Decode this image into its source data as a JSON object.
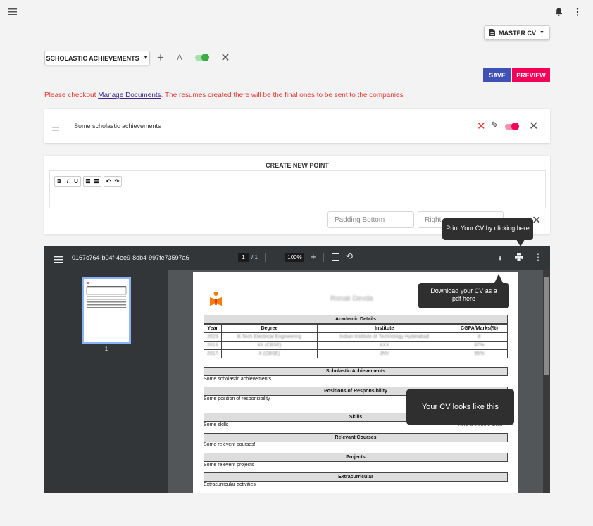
{
  "header": {
    "master_cv_label": "MASTER CV"
  },
  "section_select": {
    "label": "SCHOLASTIC ACHIEVEMENTS"
  },
  "actions": {
    "save_label": "SAVE",
    "preview_label": "PREVIEW"
  },
  "notice": {
    "prefix": "Please checkout ",
    "link_text": "Manage Documents",
    "suffix": ". The resumes created there will be the final ones to be sent to the companies"
  },
  "point": {
    "text": "Some scholastic achievements"
  },
  "create_point": {
    "title": "CREATE NEW POINT",
    "toolbar": [
      "B",
      "I",
      "U"
    ],
    "padding_bottom_placeholder": "Padding Bottom",
    "right_placeholder": "Right"
  },
  "tooltips": {
    "print": "Print Your CV by clicking here",
    "download": "Download your CV as a pdf here",
    "cv_preview": "Your CV looks like this"
  },
  "pdf_viewer": {
    "filename": "0167c764-b04f-4ee9-8db4-997fe73597a6",
    "page_current": "1",
    "page_total": "/ 1",
    "zoom": "100%",
    "thumb_label": "1"
  },
  "cv": {
    "name": "Ronak Devda",
    "academic_title": "Academic Details",
    "columns": [
      "Year",
      "Degree",
      "Institute",
      "CGPA/Marks(%)"
    ],
    "rows": [
      [
        "2023",
        "B.Tech Electrical Engineering",
        "Indian Institute of Technology Hyderabad",
        "8"
      ],
      [
        "2019",
        "XII (CBSE)",
        "XXX",
        "87%"
      ],
      [
        "2017",
        "X (CBSE)",
        "JNV",
        "95%"
      ]
    ],
    "sections": [
      {
        "title": "Scholastic Achievements",
        "text": "Some scholastic achievements"
      },
      {
        "title": "Positions of Responsibility",
        "text": "Some position of responsibility"
      },
      {
        "title": "Skills",
        "text": "Some skills",
        "right_text": "here are some skills"
      },
      {
        "title": "Relevant Courses",
        "text": "Some relevent courses!!"
      },
      {
        "title": "Projects",
        "text": "Some relevent projects"
      },
      {
        "title": "Extracurricular",
        "text": "Extracurricular activities"
      }
    ]
  },
  "colors": {
    "primary": "#3f51b5",
    "accent": "#f50057",
    "error": "#e53935",
    "toggle_on": "#3aae45"
  }
}
